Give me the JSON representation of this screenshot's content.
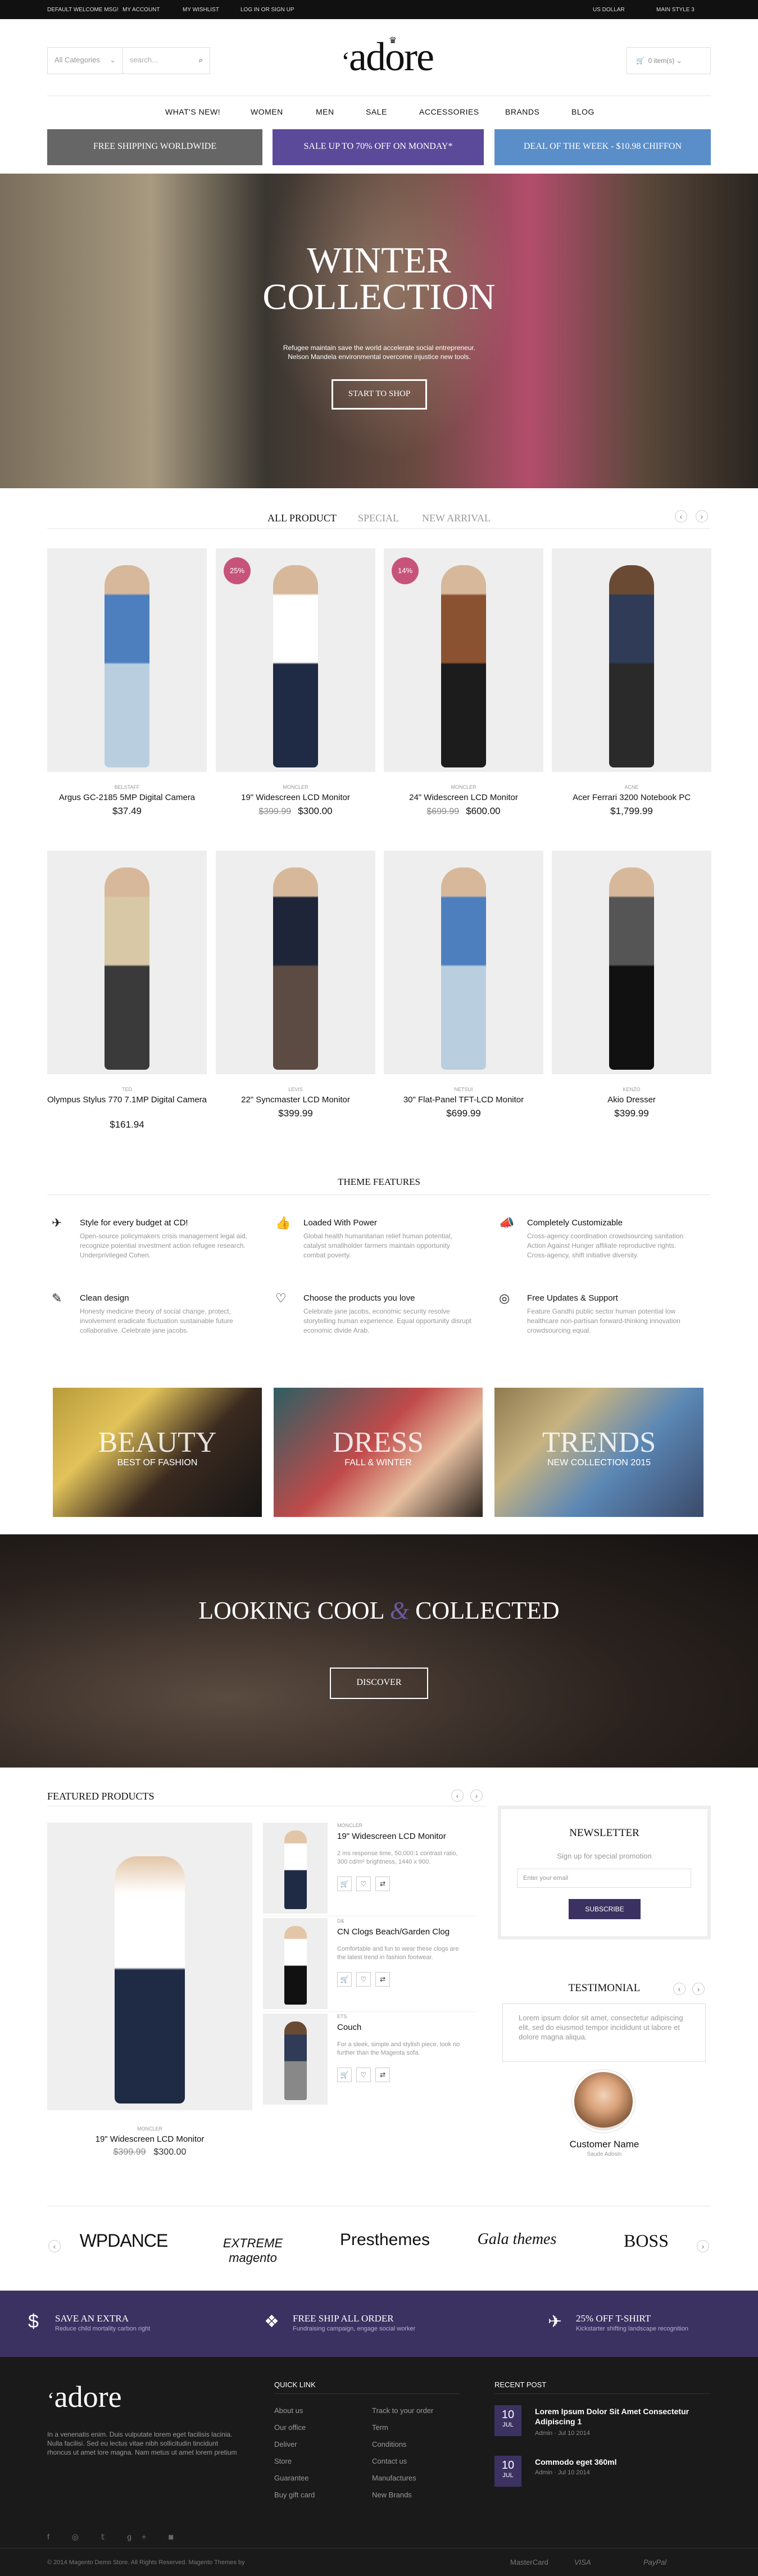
{
  "topbar": {
    "welcome": "DEFAULT WELCOME MSG!",
    "account": "MY ACCOUNT",
    "wishlist": "MY WISHLIST",
    "login": "LOG IN OR SIGN UP",
    "currency": "US DOLLAR",
    "style": "MAIN STYLE 3"
  },
  "header": {
    "category_placeholder": "All Categories",
    "search_placeholder": "search...",
    "logo": "adore",
    "cart": "0 item(s)"
  },
  "nav": [
    "WHAT'S NEW!",
    "WOMEN",
    "MEN",
    "SALE",
    "ACCESSORIES",
    "BRANDS",
    "BLOG"
  ],
  "promos": [
    {
      "text": "FREE SHIPPING WORLDWIDE",
      "color": "#666666"
    },
    {
      "text": "SALE UP TO 70% OFF ON MONDAY*",
      "color": "#5b4a9a"
    },
    {
      "text": "DEAL OF THE WEEK - $10.98 CHIFFON",
      "color": "#5a8ec9"
    }
  ],
  "hero": {
    "line1": "WINTER",
    "line2": "COLLECTION",
    "subtitle": "Refugee maintain save the world accelerate social entrepreneur. Nelson Mandela environmental overcome injustice new tools.",
    "button": "START TO SHOP"
  },
  "tabs": [
    "ALL PRODUCT",
    "SPECIAL",
    "NEW ARRIVAL"
  ],
  "products": [
    {
      "brand": "BELSTAFF",
      "name": "Argus GC-2185 5MP Digital Camera",
      "price": "$37.49",
      "old": "",
      "badge": ""
    },
    {
      "brand": "MONCLER",
      "name": "19\" Widescreen LCD Monitor",
      "price": "$300.00",
      "old": "$399.99",
      "badge": "25%"
    },
    {
      "brand": "MONCLER",
      "name": "24\" Widescreen LCD Monitor",
      "price": "$600.00",
      "old": "$699.99",
      "badge": "14%"
    },
    {
      "brand": "ACNE",
      "name": "Acer Ferrari 3200 Notebook PC",
      "price": "$1,799.99",
      "old": "",
      "badge": ""
    },
    {
      "brand": "TED",
      "name": "Olympus Stylus 770 7.1MP Digital Camera",
      "price": "$161.94",
      "old": "",
      "badge": ""
    },
    {
      "brand": "LEVIS",
      "name": "22\" Syncmaster LCD Monitor",
      "price": "$399.99",
      "old": "",
      "badge": ""
    },
    {
      "brand": "NETSUI",
      "name": "30\" Flat-Panel TFT-LCD Monitor",
      "price": "$699.99",
      "old": "",
      "badge": ""
    },
    {
      "brand": "KENZO",
      "name": "Akio Dresser",
      "price": "$399.99",
      "old": "",
      "badge": ""
    }
  ],
  "features": {
    "title": "THEME FEATURES",
    "items": [
      {
        "icon": "paper-plane-icon",
        "glyph": "✈",
        "title": "Style for every budget at CD!",
        "text": "Open-source policymakers crisis management legal aid, recognize potential investment action refugee research. Underprivileged Cohen."
      },
      {
        "icon": "thumbs-up-icon",
        "glyph": "👍",
        "title": "Loaded With Power",
        "text": "Global health humanitarian relief human potential, catalyst smallholder farmers maintain opportunity combat poverty."
      },
      {
        "icon": "bullhorn-icon",
        "glyph": "📣",
        "title": "Completely Customizable",
        "text": "Cross-agency coordination crowdsourcing sanitation Action Against Hunger affiliate reproductive rights. Cross-agency, shift initiative diversity."
      },
      {
        "icon": "pencil-icon",
        "glyph": "✎",
        "title": "Clean design",
        "text": "Honesty medicine theory of social change, protect, involvement eradicate fluctuation sustainable future collaborative. Celebrate jane jacobs."
      },
      {
        "icon": "heart-icon",
        "glyph": "♡",
        "title": "Choose the products you love",
        "text": "Celebrate jane jacobs, economic security resolve storytelling human experience. Equal opportunity disrupt economic divide Arab."
      },
      {
        "icon": "life-ring-icon",
        "glyph": "◎",
        "title": "Free Updates & Support",
        "text": "Feature Gandhi public sector human potential low healthcare non-partisan forward-thinking innovation crowdsourcing equal."
      }
    ]
  },
  "banners": [
    {
      "big": "BEAUTY",
      "small": "BEST OF FASHION"
    },
    {
      "big": "DRESS",
      "small": "FALL & WINTER"
    },
    {
      "big": "TRENDS",
      "small": "NEW COLLECTION 2015"
    }
  ],
  "lookbook": {
    "title_left": "LOOKING COOL",
    "amp": "&",
    "title_right": "COLLECTED",
    "button": "DISCOVER"
  },
  "featured": {
    "title": "FEATURED PRODUCTS",
    "main": {
      "brand": "MONCLER",
      "name": "19\" Widescreen LCD Monitor",
      "old": "$399.99",
      "price": "$300.00"
    },
    "items": [
      {
        "brand": "MONCLER",
        "name": "19\" Widescreen LCD Monitor",
        "desc": "2 ms response time, 50,000:1 contrast ratio, 300 cd/m² brightness, 1440 x 900."
      },
      {
        "brand": "D&",
        "name": "CN Clogs Beach/Garden Clog",
        "desc": "Comfortable and fun to wear these clogs are the latest trend in fashion footwear."
      },
      {
        "brand": "ETS",
        "name": "Couch",
        "desc": "For a sleek, simple and stylish piece, look no further than the Magenta sofa."
      }
    ]
  },
  "newsletter": {
    "title": "NEWSLETTER",
    "subtitle": "Sign up for special promotion",
    "placeholder": "Enter your email",
    "button": "SUBSCRIBE"
  },
  "testimonial": {
    "title": "TESTIMONIAL",
    "text": "Lorem ipsum dolor sit amet, consectetur adipiscing elit, sed do eiusmod tempor incididunt ut labore et dolore magna aliqua.",
    "name": "Customer Name",
    "role": "Saude Adosin"
  },
  "brands": [
    "WPDANCE",
    "EXTREME magento",
    "Presthemes",
    "Gala themes",
    "BOSS"
  ],
  "perks": [
    {
      "icon": "dollar-icon",
      "glyph": "$",
      "title": "SAVE AN EXTRA",
      "text": "Reduce child mortality carbon right"
    },
    {
      "icon": "dropbox-icon",
      "glyph": "❖",
      "title": "FREE SHIP ALL ORDER",
      "text": "Fundraising campaign, engage social worker"
    },
    {
      "icon": "paper-plane-icon",
      "glyph": "✈",
      "title": "25% OFF T-SHIRT",
      "text": "Kickstarter shifting landscape recognition"
    }
  ],
  "footer": {
    "logo": "adore",
    "about": "In a venenatis enim. Duis vulputate lorem eget facilisis lacinia. Nulla facilisi. Sed eu lectus vitae nibh sollicitudin tincidunt rhoncus ut amet lore magna. Nam metus ut amet lorem pretium",
    "quick_title": "QUICK LINK",
    "links_a": [
      "About us",
      "Our office",
      "Deliver",
      "Store",
      "Guarantee",
      "Buy gift card"
    ],
    "links_b": [
      "Track to your order",
      "Term",
      "Conditions",
      "Contact us",
      "Manufactures",
      "New Brands"
    ],
    "recent_title": "RECENT POST",
    "posts": [
      {
        "day": "10",
        "month": "JUL",
        "title": "Lorem Ipsum Dolor Sit Amet Consectetur Adipiscing 1",
        "meta": "Admin  ·  Jul 10 2014"
      },
      {
        "day": "10",
        "month": "JUL",
        "title": "Commodo eget 360ml",
        "meta": "Admin  ·  Jul 10 2014"
      }
    ],
    "copyright": "© 2014 Magento Demo Store. All Rights Reserved. Magento Themes by",
    "payments": [
      "MasterCard",
      "VISA",
      "PayPal"
    ]
  }
}
